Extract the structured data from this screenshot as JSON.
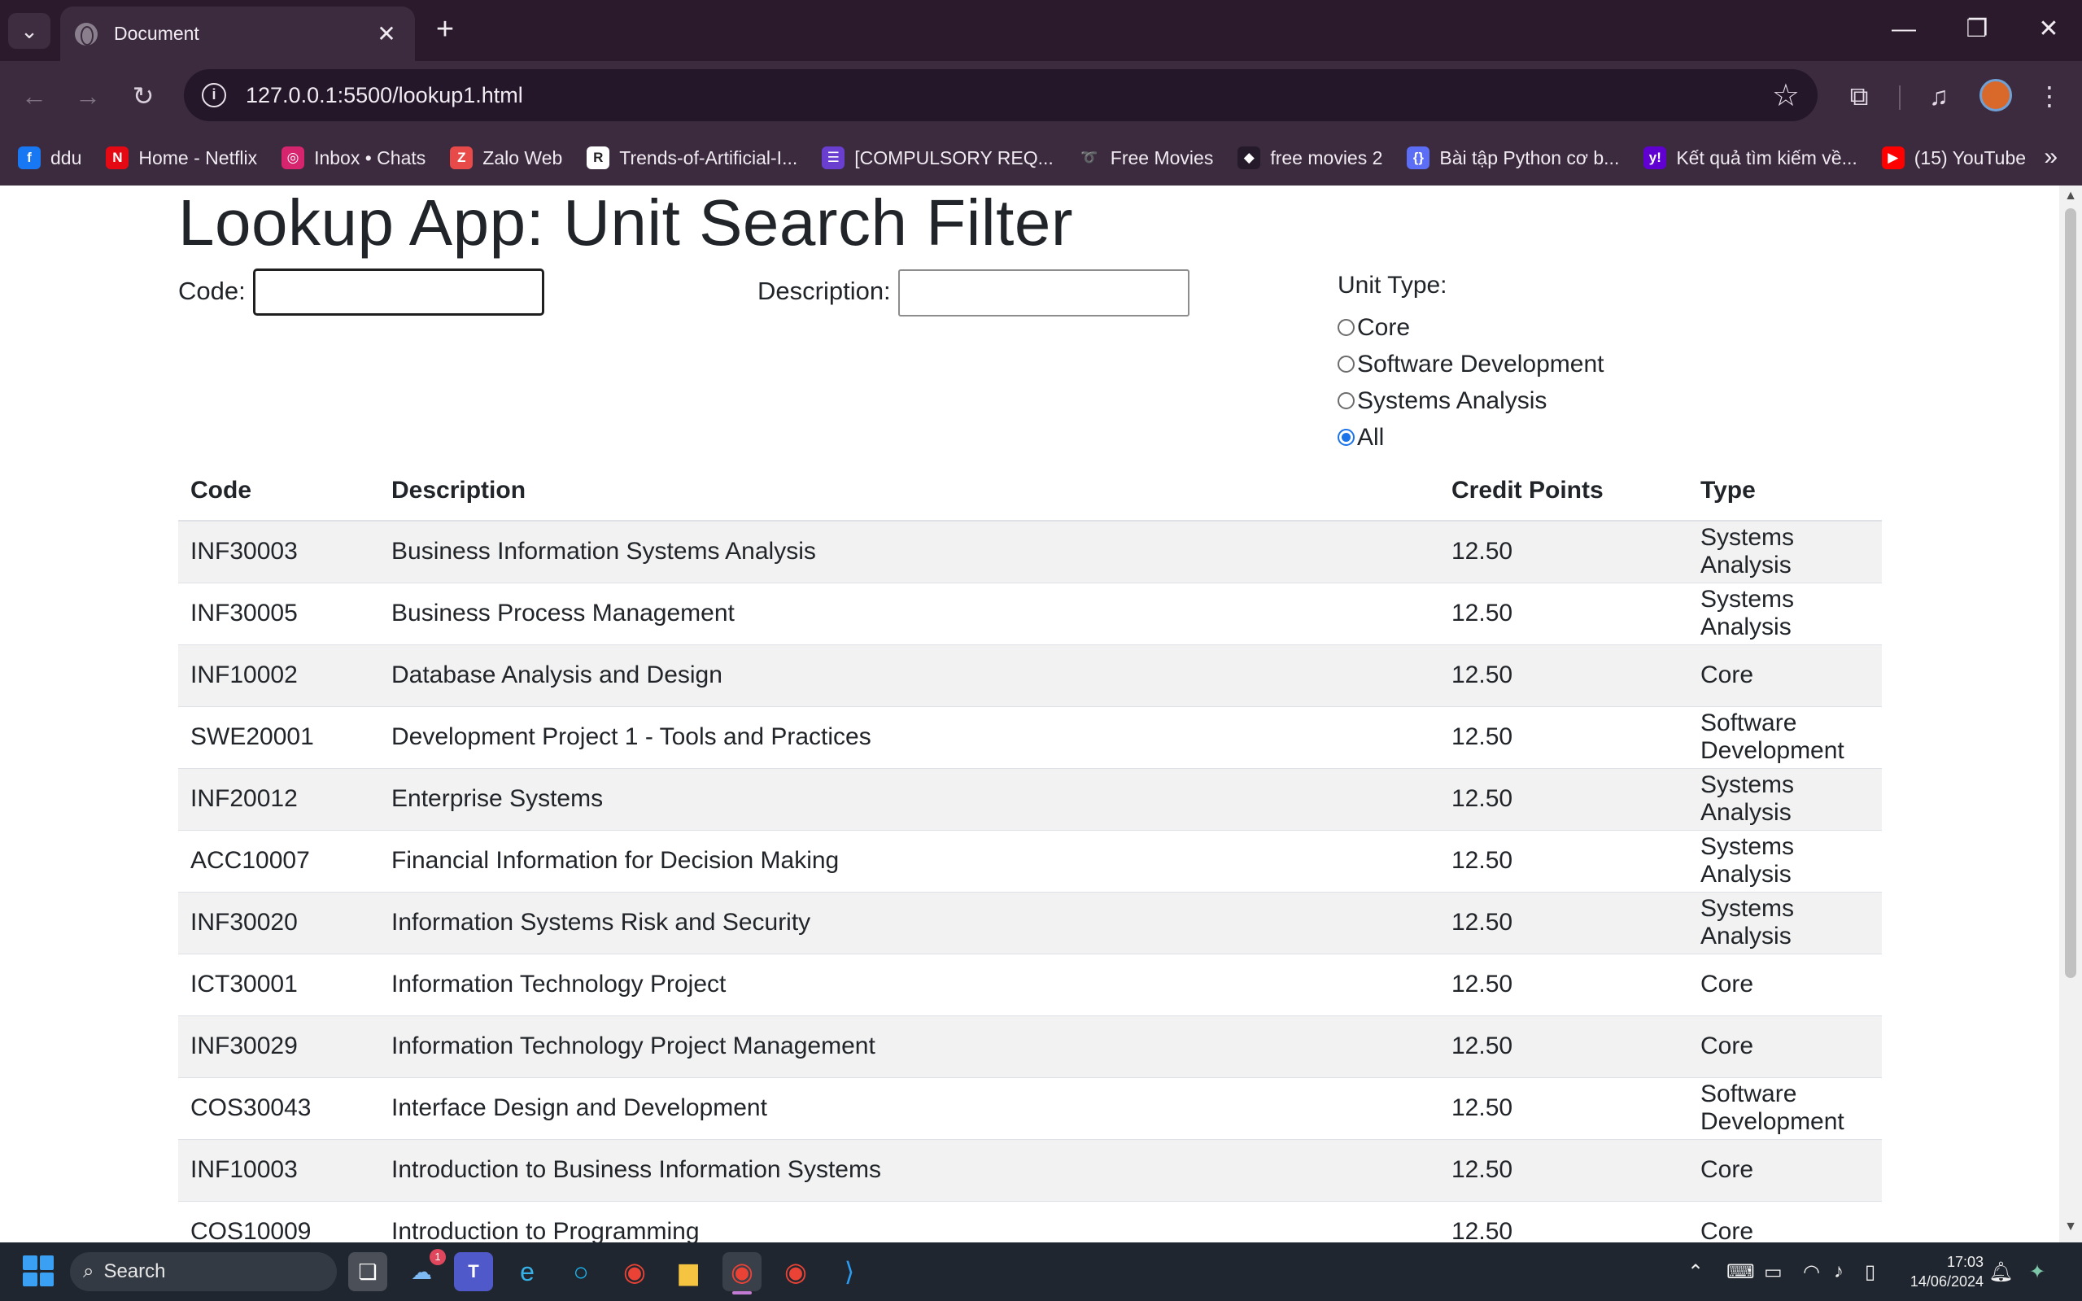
{
  "browser": {
    "tab_title": "Document",
    "url": "127.0.0.1:5500/lookup1.html",
    "bookmarks": [
      {
        "label": "ddu",
        "icon": "facebook-icon",
        "color": "#1877f2",
        "glyph": "f"
      },
      {
        "label": "Home - Netflix",
        "icon": "netflix-icon",
        "color": "#e50914",
        "glyph": "N"
      },
      {
        "label": "Inbox • Chats",
        "icon": "instagram-icon",
        "color": "#d6246e",
        "glyph": "◎"
      },
      {
        "label": "Zalo Web",
        "icon": "zalo-icon",
        "color": "#e84a4a",
        "glyph": "Z"
      },
      {
        "label": "Trends-of-Artificial-I...",
        "icon": "researchgate-icon",
        "color": "#ffffff",
        "glyph": "R"
      },
      {
        "label": "[COMPULSORY REQ...",
        "icon": "list-icon",
        "color": "#6a3fd0",
        "glyph": "☰"
      },
      {
        "label": "Free Movies",
        "icon": "movies-icon",
        "color": "#3c2a3e",
        "glyph": "➰"
      },
      {
        "label": "free movies 2",
        "icon": "diamond-icon",
        "color": "#241a2a",
        "glyph": "◆"
      },
      {
        "label": "Bài tập Python cơ b...",
        "icon": "code-icon",
        "color": "#5b6ef5",
        "glyph": "{}"
      },
      {
        "label": "Kết quả tìm kiếm về...",
        "icon": "yahoo-icon",
        "color": "#6001d2",
        "glyph": "y!"
      },
      {
        "label": "(15) YouTube",
        "icon": "youtube-icon",
        "color": "#ff0000",
        "glyph": "▶"
      }
    ]
  },
  "page": {
    "title": "Lookup App: Unit Search Filter",
    "code_label": "Code:",
    "code_value": "",
    "description_label": "Description:",
    "description_value": "",
    "unit_type_label": "Unit Type:",
    "unit_type_options": [
      "Core",
      "Software Development",
      "Systems Analysis",
      "All"
    ],
    "unit_type_selected": "All"
  },
  "table": {
    "headers": [
      "Code",
      "Description",
      "Credit Points",
      "Type"
    ],
    "rows": [
      [
        "INF30003",
        "Business Information Systems Analysis",
        "12.50",
        "Systems Analysis"
      ],
      [
        "INF30005",
        "Business Process Management",
        "12.50",
        "Systems Analysis"
      ],
      [
        "INF10002",
        "Database Analysis and Design",
        "12.50",
        "Core"
      ],
      [
        "SWE20001",
        "Development Project 1 - Tools and Practices",
        "12.50",
        "Software Development"
      ],
      [
        "INF20012",
        "Enterprise Systems",
        "12.50",
        "Systems Analysis"
      ],
      [
        "ACC10007",
        "Financial Information for Decision Making",
        "12.50",
        "Systems Analysis"
      ],
      [
        "INF30020",
        "Information Systems Risk and Security",
        "12.50",
        "Systems Analysis"
      ],
      [
        "ICT30001",
        "Information Technology Project",
        "12.50",
        "Core"
      ],
      [
        "INF30029",
        "Information Technology Project Management",
        "12.50",
        "Core"
      ],
      [
        "COS30043",
        "Interface Design and Development",
        "12.50",
        "Software Development"
      ],
      [
        "INF10003",
        "Introduction to Business Information Systems",
        "12.50",
        "Core"
      ],
      [
        "COS10009",
        "Introduction to Programming",
        "12.50",
        "Core"
      ]
    ]
  },
  "taskbar": {
    "search_label": "Search",
    "time": "17:03",
    "date": "14/06/2024",
    "teams_badge": "1"
  },
  "colors": {
    "accent": "#1a73e8",
    "chrome_bg": "#3c2a3e",
    "striped_row": "#f2f2f2"
  }
}
